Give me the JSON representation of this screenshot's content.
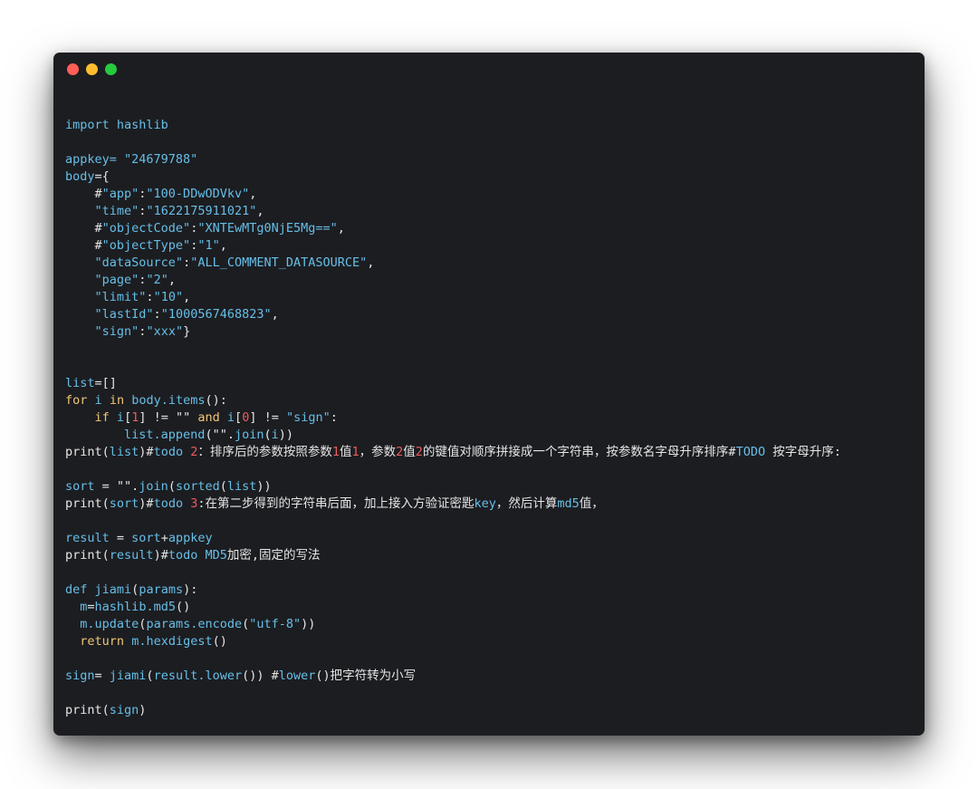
{
  "window": {
    "controls": [
      {
        "name": "close",
        "color": "#ff5f56"
      },
      {
        "name": "minimize",
        "color": "#ffbd2e"
      },
      {
        "name": "maximize",
        "color": "#27c93f"
      }
    ]
  },
  "colors": {
    "background": "#1c1d21",
    "default": "#e6e6e6",
    "identifier": "#66bfe8",
    "keyword": "#f0c674",
    "number": "#ee5b5b"
  },
  "code": {
    "lines": [
      [],
      [
        {
          "t": "import hashlib",
          "c": "identifier"
        }
      ],
      [],
      [
        {
          "t": "appkey= \"24679788\"",
          "c": "identifier"
        }
      ],
      [
        {
          "t": "body",
          "c": "identifier"
        },
        {
          "t": "={",
          "c": "default"
        }
      ],
      [
        {
          "t": "    #",
          "c": "default"
        },
        {
          "t": "\"app\"",
          "c": "identifier"
        },
        {
          "t": ":",
          "c": "default"
        },
        {
          "t": "\"100-DDwODVkv\"",
          "c": "identifier"
        },
        {
          "t": ",",
          "c": "default"
        }
      ],
      [
        {
          "t": "    ",
          "c": "default"
        },
        {
          "t": "\"time\"",
          "c": "identifier"
        },
        {
          "t": ":",
          "c": "default"
        },
        {
          "t": "\"1622175911021\"",
          "c": "identifier"
        },
        {
          "t": ",",
          "c": "default"
        }
      ],
      [
        {
          "t": "    #",
          "c": "default"
        },
        {
          "t": "\"objectCode\"",
          "c": "identifier"
        },
        {
          "t": ":",
          "c": "default"
        },
        {
          "t": "\"XNTEwMTg0NjE5Mg==\"",
          "c": "identifier"
        },
        {
          "t": ",",
          "c": "default"
        }
      ],
      [
        {
          "t": "    #",
          "c": "default"
        },
        {
          "t": "\"objectType\"",
          "c": "identifier"
        },
        {
          "t": ":",
          "c": "default"
        },
        {
          "t": "\"1\"",
          "c": "identifier"
        },
        {
          "t": ",",
          "c": "default"
        }
      ],
      [
        {
          "t": "    ",
          "c": "default"
        },
        {
          "t": "\"dataSource\"",
          "c": "identifier"
        },
        {
          "t": ":",
          "c": "default"
        },
        {
          "t": "\"ALL_COMMENT_DATASOURCE\"",
          "c": "identifier"
        },
        {
          "t": ",",
          "c": "default"
        }
      ],
      [
        {
          "t": "    ",
          "c": "default"
        },
        {
          "t": "\"page\"",
          "c": "identifier"
        },
        {
          "t": ":",
          "c": "default"
        },
        {
          "t": "\"2\"",
          "c": "identifier"
        },
        {
          "t": ",",
          "c": "default"
        }
      ],
      [
        {
          "t": "    ",
          "c": "default"
        },
        {
          "t": "\"limit\"",
          "c": "identifier"
        },
        {
          "t": ":",
          "c": "default"
        },
        {
          "t": "\"10\"",
          "c": "identifier"
        },
        {
          "t": ",",
          "c": "default"
        }
      ],
      [
        {
          "t": "    ",
          "c": "default"
        },
        {
          "t": "\"lastId\"",
          "c": "identifier"
        },
        {
          "t": ":",
          "c": "default"
        },
        {
          "t": "\"1000567468823\"",
          "c": "identifier"
        },
        {
          "t": ",",
          "c": "default"
        }
      ],
      [
        {
          "t": "    ",
          "c": "default"
        },
        {
          "t": "\"sign\"",
          "c": "identifier"
        },
        {
          "t": ":",
          "c": "default"
        },
        {
          "t": "\"xxx\"",
          "c": "identifier"
        },
        {
          "t": "}",
          "c": "default"
        }
      ],
      [],
      [],
      [
        {
          "t": "list",
          "c": "identifier"
        },
        {
          "t": "=[]",
          "c": "default"
        }
      ],
      [
        {
          "t": "for",
          "c": "keyword"
        },
        {
          "t": " ",
          "c": "default"
        },
        {
          "t": "i",
          "c": "identifier"
        },
        {
          "t": " ",
          "c": "default"
        },
        {
          "t": "in",
          "c": "keyword"
        },
        {
          "t": " ",
          "c": "default"
        },
        {
          "t": "body.items",
          "c": "identifier"
        },
        {
          "t": "():",
          "c": "default"
        }
      ],
      [
        {
          "t": "    ",
          "c": "default"
        },
        {
          "t": "if",
          "c": "keyword"
        },
        {
          "t": " ",
          "c": "default"
        },
        {
          "t": "i",
          "c": "identifier"
        },
        {
          "t": "[",
          "c": "default"
        },
        {
          "t": "1",
          "c": "number"
        },
        {
          "t": "] != \"\" ",
          "c": "default"
        },
        {
          "t": "and",
          "c": "keyword"
        },
        {
          "t": " ",
          "c": "default"
        },
        {
          "t": "i",
          "c": "identifier"
        },
        {
          "t": "[",
          "c": "default"
        },
        {
          "t": "0",
          "c": "number"
        },
        {
          "t": "] != ",
          "c": "default"
        },
        {
          "t": "\"sign\"",
          "c": "identifier"
        },
        {
          "t": ":",
          "c": "default"
        }
      ],
      [
        {
          "t": "        ",
          "c": "default"
        },
        {
          "t": "list.append",
          "c": "identifier"
        },
        {
          "t": "(\"\".",
          "c": "default"
        },
        {
          "t": "join",
          "c": "identifier"
        },
        {
          "t": "(",
          "c": "default"
        },
        {
          "t": "i",
          "c": "identifier"
        },
        {
          "t": "))",
          "c": "default"
        }
      ],
      [
        {
          "t": "print",
          "c": "default"
        },
        {
          "t": "(",
          "c": "default"
        },
        {
          "t": "list",
          "c": "identifier"
        },
        {
          "t": ")#",
          "c": "default"
        },
        {
          "t": "todo",
          "c": "identifier"
        },
        {
          "t": " ",
          "c": "default"
        },
        {
          "t": "2",
          "c": "number"
        },
        {
          "t": "：排序后的参数按照参数",
          "c": "default"
        },
        {
          "t": "1",
          "c": "number"
        },
        {
          "t": "值",
          "c": "default"
        },
        {
          "t": "1",
          "c": "number"
        },
        {
          "t": "，参数",
          "c": "default"
        },
        {
          "t": "2",
          "c": "number"
        },
        {
          "t": "值",
          "c": "default"
        },
        {
          "t": "2",
          "c": "number"
        },
        {
          "t": "的键值对顺序拼接成一个字符串，按参数名字母升序排序#",
          "c": "default"
        },
        {
          "t": "TODO",
          "c": "identifier"
        },
        {
          "t": " 按字母升序:",
          "c": "default"
        }
      ],
      [],
      [
        {
          "t": "sort",
          "c": "identifier"
        },
        {
          "t": " = \"\".",
          "c": "default"
        },
        {
          "t": "join",
          "c": "identifier"
        },
        {
          "t": "(",
          "c": "default"
        },
        {
          "t": "sorted",
          "c": "identifier"
        },
        {
          "t": "(",
          "c": "default"
        },
        {
          "t": "list",
          "c": "identifier"
        },
        {
          "t": "))",
          "c": "default"
        }
      ],
      [
        {
          "t": "print",
          "c": "default"
        },
        {
          "t": "(",
          "c": "default"
        },
        {
          "t": "sort",
          "c": "identifier"
        },
        {
          "t": ")#",
          "c": "default"
        },
        {
          "t": "todo",
          "c": "identifier"
        },
        {
          "t": " ",
          "c": "default"
        },
        {
          "t": "3",
          "c": "number"
        },
        {
          "t": ":在第二步得到的字符串后面，加上接入方验证密匙",
          "c": "default"
        },
        {
          "t": "key",
          "c": "identifier"
        },
        {
          "t": "，然后计算",
          "c": "default"
        },
        {
          "t": "md5",
          "c": "identifier"
        },
        {
          "t": "值，",
          "c": "default"
        }
      ],
      [],
      [
        {
          "t": "result",
          "c": "identifier"
        },
        {
          "t": " = ",
          "c": "default"
        },
        {
          "t": "sort",
          "c": "identifier"
        },
        {
          "t": "+",
          "c": "default"
        },
        {
          "t": "appkey",
          "c": "identifier"
        }
      ],
      [
        {
          "t": "print",
          "c": "default"
        },
        {
          "t": "(",
          "c": "default"
        },
        {
          "t": "result",
          "c": "identifier"
        },
        {
          "t": ")#",
          "c": "default"
        },
        {
          "t": "todo",
          "c": "identifier"
        },
        {
          "t": " ",
          "c": "default"
        },
        {
          "t": "MD5",
          "c": "identifier"
        },
        {
          "t": "加密,固定的写法",
          "c": "default"
        }
      ],
      [],
      [
        {
          "t": "def",
          "c": "identifier"
        },
        {
          "t": " ",
          "c": "default"
        },
        {
          "t": "jiami",
          "c": "identifier"
        },
        {
          "t": "(",
          "c": "default"
        },
        {
          "t": "params",
          "c": "identifier"
        },
        {
          "t": "):",
          "c": "default"
        }
      ],
      [
        {
          "t": "  ",
          "c": "default"
        },
        {
          "t": "m",
          "c": "identifier"
        },
        {
          "t": "=",
          "c": "default"
        },
        {
          "t": "hashlib.md5",
          "c": "identifier"
        },
        {
          "t": "()",
          "c": "default"
        }
      ],
      [
        {
          "t": "  ",
          "c": "default"
        },
        {
          "t": "m.update",
          "c": "identifier"
        },
        {
          "t": "(",
          "c": "default"
        },
        {
          "t": "params.encode",
          "c": "identifier"
        },
        {
          "t": "(",
          "c": "default"
        },
        {
          "t": "\"utf-8\"",
          "c": "identifier"
        },
        {
          "t": "))",
          "c": "default"
        }
      ],
      [
        {
          "t": "  ",
          "c": "default"
        },
        {
          "t": "return",
          "c": "keyword"
        },
        {
          "t": " ",
          "c": "default"
        },
        {
          "t": "m.hexdigest",
          "c": "identifier"
        },
        {
          "t": "()",
          "c": "default"
        }
      ],
      [],
      [
        {
          "t": "sign",
          "c": "identifier"
        },
        {
          "t": "= ",
          "c": "default"
        },
        {
          "t": "jiami",
          "c": "identifier"
        },
        {
          "t": "(",
          "c": "default"
        },
        {
          "t": "result.lower",
          "c": "identifier"
        },
        {
          "t": "()) #",
          "c": "default"
        },
        {
          "t": "lower",
          "c": "identifier"
        },
        {
          "t": "()把字符转为小写",
          "c": "default"
        }
      ],
      [],
      [
        {
          "t": "print",
          "c": "default"
        },
        {
          "t": "(",
          "c": "default"
        },
        {
          "t": "sign",
          "c": "identifier"
        },
        {
          "t": ")",
          "c": "default"
        }
      ]
    ]
  }
}
